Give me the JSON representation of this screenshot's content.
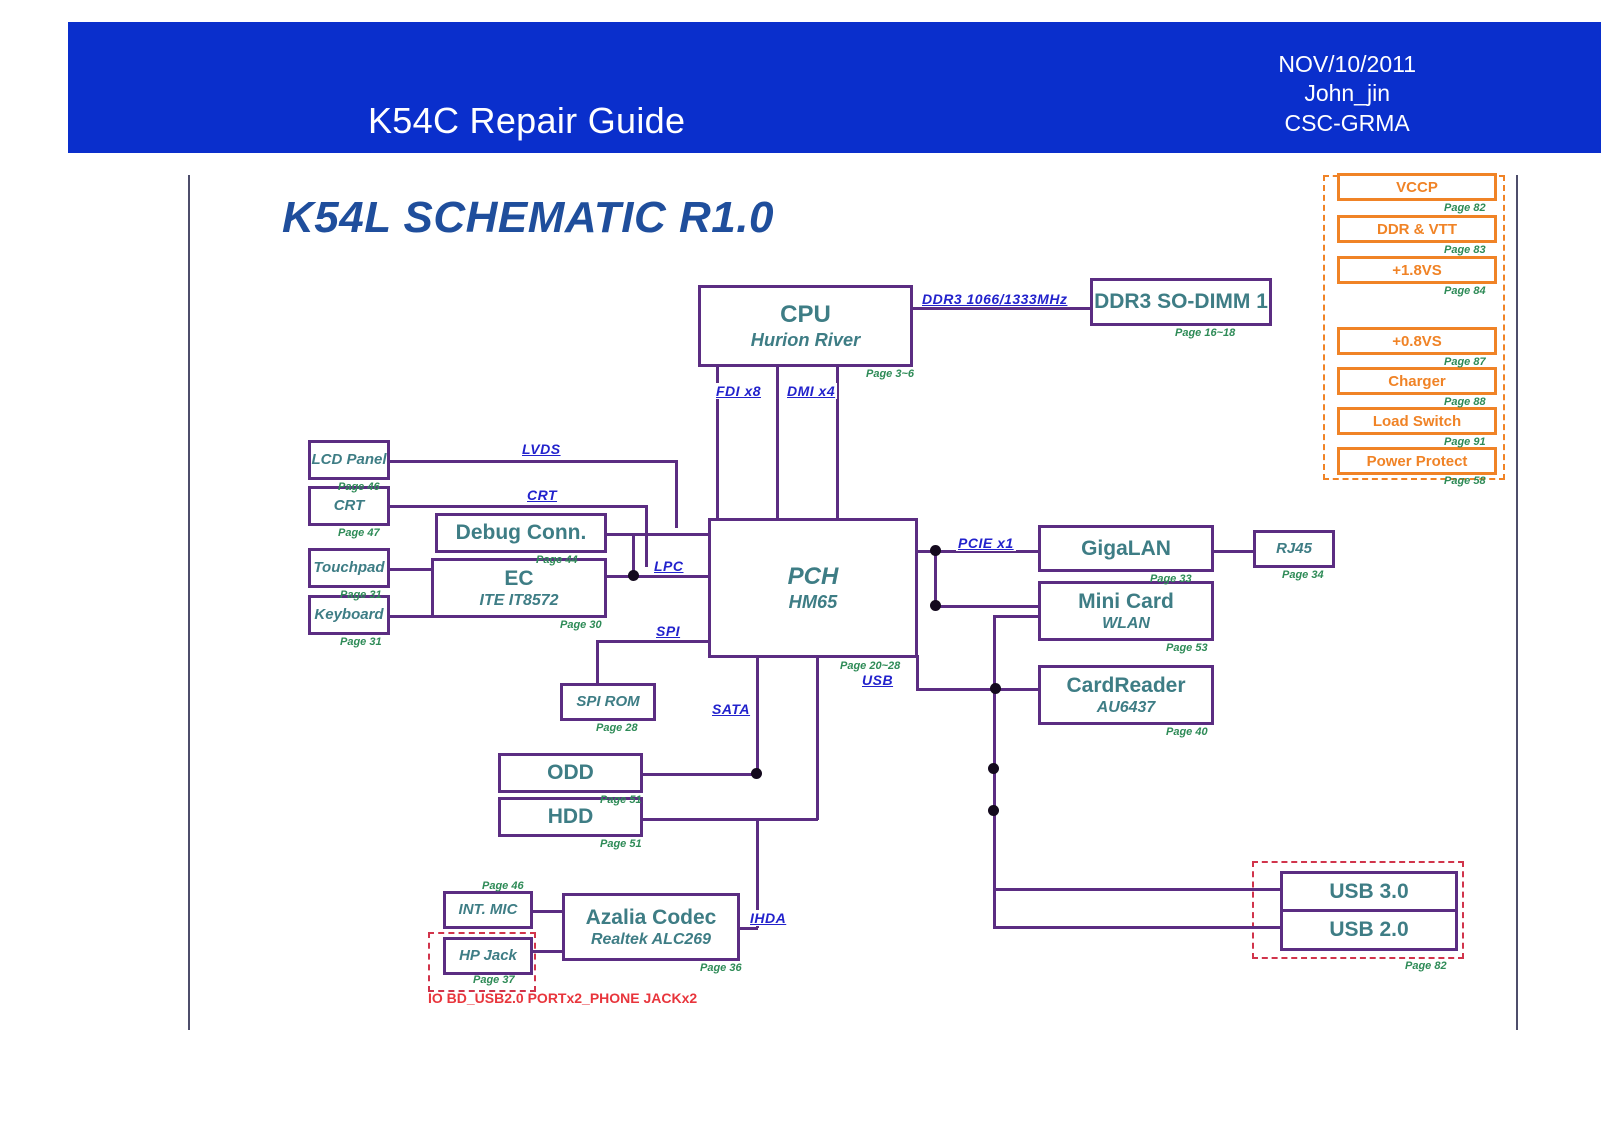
{
  "header": {
    "title": "K54C Repair Guide",
    "date": "NOV/10/2011",
    "author": "John_jin",
    "org": "CSC-GRMA",
    "bar_color": "#0A2FCC"
  },
  "schematic": {
    "title": "K54L SCHEMATIC R1.0",
    "title_color": "#1F4E9C",
    "block_color": "#5B2D82",
    "text_color": "#3E7D85",
    "page_label_color": "#2E8B57",
    "bus_label_color": "#2222CC",
    "power_color": "#F08326",
    "note_color": "#E8353C"
  },
  "blocks": [
    {
      "id": "cpu",
      "name": "CPU",
      "sub": "Hurion River",
      "page": "Page 3~6"
    },
    {
      "id": "sodimm",
      "name": "DDR3 SO-DIMM 1",
      "sub": "",
      "page": "Page 16~18"
    },
    {
      "id": "lcd",
      "name": "LCD Panel",
      "sub": "",
      "page": "Page 46"
    },
    {
      "id": "crt",
      "name": "CRT",
      "sub": "",
      "page": "Page 47"
    },
    {
      "id": "touchpad",
      "name": "Touchpad",
      "sub": "",
      "page": "Page 31"
    },
    {
      "id": "keyboard",
      "name": "Keyboard",
      "sub": "",
      "page": "Page 31"
    },
    {
      "id": "debug",
      "name": "Debug Conn.",
      "sub": "",
      "page": "Page 44"
    },
    {
      "id": "ec",
      "name": "EC",
      "sub": "ITE IT8572",
      "page": "Page 30"
    },
    {
      "id": "pch",
      "name": "PCH",
      "sub": "HM65",
      "page": "Page 20~28"
    },
    {
      "id": "gigalan",
      "name": "GigaLAN",
      "sub": "",
      "page": "Page 33"
    },
    {
      "id": "rj45",
      "name": "RJ45",
      "sub": "",
      "page": "Page 34"
    },
    {
      "id": "minicard",
      "name": "Mini Card",
      "sub": "WLAN",
      "page": "Page 53"
    },
    {
      "id": "cardreader",
      "name": "CardReader",
      "sub": "AU6437",
      "page": "Page 40"
    },
    {
      "id": "spirom",
      "name": "SPI ROM",
      "sub": "",
      "page": "Page 28"
    },
    {
      "id": "odd",
      "name": "ODD",
      "sub": "",
      "page": "Page 51"
    },
    {
      "id": "hdd",
      "name": "HDD",
      "sub": "",
      "page": "Page 51"
    },
    {
      "id": "intmic",
      "name": "INT. MIC",
      "sub": "",
      "page": "Page 46"
    },
    {
      "id": "hpjack",
      "name": "HP Jack",
      "sub": "",
      "page": "Page 37"
    },
    {
      "id": "azalia",
      "name": "Azalia Codec",
      "sub": "Realtek ALC269",
      "page": "Page 36"
    },
    {
      "id": "usb3",
      "name": "USB 3.0",
      "sub": "",
      "page": ""
    },
    {
      "id": "usb2",
      "name": "USB 2.0",
      "sub": "",
      "page": "Page 82"
    }
  ],
  "bus_labels": [
    {
      "id": "ddr3",
      "text": "DDR3 1066/1333MHz"
    },
    {
      "id": "fdi",
      "text": "FDI x8"
    },
    {
      "id": "dmi",
      "text": "DMI x4"
    },
    {
      "id": "lvds",
      "text": "LVDS"
    },
    {
      "id": "crt",
      "text": "CRT"
    },
    {
      "id": "lpc",
      "text": "LPC"
    },
    {
      "id": "spi",
      "text": "SPI"
    },
    {
      "id": "sata",
      "text": "SATA"
    },
    {
      "id": "usb",
      "text": "USB"
    },
    {
      "id": "pcie",
      "text": "PCIE x1"
    },
    {
      "id": "ihda",
      "text": "IHDA"
    }
  ],
  "power_rails": [
    {
      "id": "vccp",
      "name": "VCCP",
      "page": "Page 82"
    },
    {
      "id": "ddrvtt",
      "name": "DDR & VTT",
      "page": "Page 83"
    },
    {
      "id": "v18",
      "name": "+1.8VS",
      "page": "Page 84"
    },
    {
      "id": "v08",
      "name": "+0.8VS",
      "page": "Page 87"
    },
    {
      "id": "charger",
      "name": "Charger",
      "page": "Page 88"
    },
    {
      "id": "loadsw",
      "name": "Load Switch",
      "page": "Page 91"
    },
    {
      "id": "protect",
      "name": "Power Protect",
      "page": "Page 58"
    }
  ],
  "notes": {
    "io_board": "IO BD_USB2.0 PORTx2_PHONE JACKx2"
  }
}
